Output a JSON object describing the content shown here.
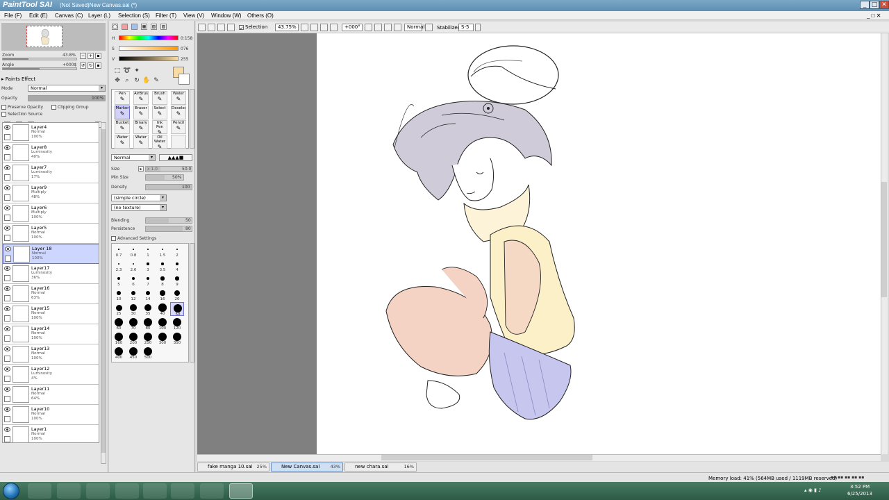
{
  "window": {
    "app_name": "PaintTool SAI",
    "title": "(Not Saved)New Canvas.sai (*)",
    "btn_minimize": "_",
    "btn_maximize": "□",
    "btn_close": "✕"
  },
  "menu": [
    {
      "label": "File (F)"
    },
    {
      "label": "Edit (E)"
    },
    {
      "label": "Canvas (C)"
    },
    {
      "label": "Layer (L)"
    },
    {
      "label": "Selection (S)"
    },
    {
      "label": "Filter (T)"
    },
    {
      "label": "View (V)"
    },
    {
      "label": "Window (W)"
    },
    {
      "label": "Others (O)"
    }
  ],
  "navigator": {
    "zoom_label": "Zoom",
    "zoom_value": "43.8%",
    "angle_label": "Angle",
    "angle_value": "+000$"
  },
  "paint_effect": {
    "title": "Paints Effect",
    "mode_label": "Mode",
    "mode_value": "Normal",
    "opacity_label": "Opacity",
    "opacity_value": "100%",
    "opacity_fraction": 1.0,
    "preserve_opacity": "Preserve Opacity",
    "clipping_group": "Clipping Group",
    "selection_source": "Selection Source"
  },
  "layers": [
    {
      "name": "Layer4",
      "mode": "Normal",
      "opacity": "100%",
      "selected": false
    },
    {
      "name": "Layer8",
      "mode": "Luminosity",
      "opacity": "40%",
      "selected": false
    },
    {
      "name": "Layer7",
      "mode": "Luminosity",
      "opacity": "17%",
      "selected": false
    },
    {
      "name": "Layer9",
      "mode": "Multiply",
      "opacity": "48%",
      "selected": false
    },
    {
      "name": "Layer6",
      "mode": "Multiply",
      "opacity": "100%",
      "selected": false
    },
    {
      "name": "Layer5",
      "mode": "Normal",
      "opacity": "100%",
      "selected": false
    },
    {
      "name": "Layer 18",
      "mode": "Normal",
      "opacity": "100%",
      "selected": true
    },
    {
      "name": "Layer17",
      "mode": "Luminosity",
      "opacity": "36%",
      "selected": false
    },
    {
      "name": "Layer16",
      "mode": "Normal",
      "opacity": "63%",
      "selected": false
    },
    {
      "name": "Layer15",
      "mode": "Normal",
      "opacity": "100%",
      "selected": false
    },
    {
      "name": "Layer14",
      "mode": "Normal",
      "opacity": "100%",
      "selected": false
    },
    {
      "name": "Layer13",
      "mode": "Normal",
      "opacity": "100%",
      "selected": false
    },
    {
      "name": "Layer12",
      "mode": "Luminosity",
      "opacity": "4%",
      "selected": false
    },
    {
      "name": "Layer11",
      "mode": "Normal",
      "opacity": "64%",
      "selected": false
    },
    {
      "name": "Layer10",
      "mode": "Normal",
      "opacity": "100%",
      "selected": false
    },
    {
      "name": "Layer1",
      "mode": "Normal",
      "opacity": "100%",
      "selected": false
    }
  ],
  "color": {
    "h_label": "H",
    "h_value": "0:158",
    "s_label": "S",
    "s_value": "076",
    "v_label": "V",
    "v_value": "255",
    "primary": "#f9dca4",
    "secondary": "#ffffff"
  },
  "brush_tools": [
    {
      "label": "Pen",
      "selected": false
    },
    {
      "label": "AirBrush",
      "selected": false
    },
    {
      "label": "Brush",
      "selected": false
    },
    {
      "label": "Water",
      "selected": false
    },
    {
      "label": "Marker",
      "selected": true
    },
    {
      "label": "Eraser",
      "selected": false
    },
    {
      "label": "Select",
      "selected": false
    },
    {
      "label": "Deselect",
      "selected": false
    },
    {
      "label": "Bucket",
      "selected": false
    },
    {
      "label": "Binary",
      "selected": false
    },
    {
      "label": "Ink Pen",
      "selected": false
    },
    {
      "label": "Pencil",
      "selected": false
    },
    {
      "label": "Water",
      "selected": false
    },
    {
      "label": "Water",
      "selected": false
    },
    {
      "label": "Oil Water",
      "selected": false
    },
    {
      "label": "",
      "selected": false
    }
  ],
  "brush_settings": {
    "blend_mode": "Normal",
    "size_label": "Size",
    "size_mult": "x 1.0",
    "size_value": "50.0",
    "min_size_label": "Min Size",
    "min_size_value": "50%",
    "density_label": "Density",
    "density_value": "100",
    "shape": "(simple circle)",
    "texture": "(no texture)",
    "blending_label": "Blending",
    "blending_value": "50",
    "persistence_label": "Persistence",
    "persistence_value": "80",
    "advanced_label": "Advanced Settings"
  },
  "brush_sizes": [
    "0.7",
    "0.8",
    "1",
    "1.5",
    "2",
    "2.3",
    "2.6",
    "3",
    "3.5",
    "4",
    "5",
    "6",
    "7",
    "8",
    "9",
    "10",
    "12",
    "14",
    "16",
    "20",
    "25",
    "30",
    "35",
    "40",
    "50",
    "60",
    "70",
    "80",
    "100",
    "120",
    "160",
    "200",
    "250",
    "300",
    "350",
    "400",
    "450",
    "500"
  ],
  "canvas_toolbar": {
    "selection_label": "Selection",
    "zoom": "43.75%",
    "angle": "+000°",
    "mode": "Normal",
    "stabilizer_label": "Stabilizer",
    "stabilizer_value": "S-5"
  },
  "file_tabs": [
    {
      "name": "fake manga 10.sai",
      "zoom": "25%",
      "active": false
    },
    {
      "name": "New Canvas.sai",
      "zoom": "43%",
      "active": true
    },
    {
      "name": "new chara.sai",
      "zoom": "16%",
      "active": false
    }
  ],
  "status": {
    "memory": "Memory load: 41% (564MB used / 1119MB reserved)"
  },
  "taskbar": {
    "time": "3:52 PM",
    "date": "6/25/2013"
  }
}
